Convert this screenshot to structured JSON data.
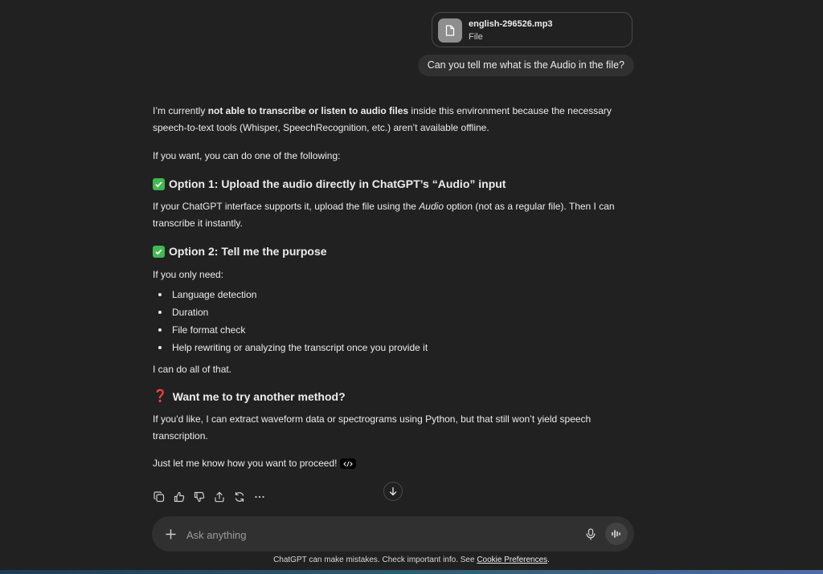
{
  "attachment": {
    "filename": "english-296526.mp3",
    "type_label": "File",
    "icon": "file-icon"
  },
  "user_message": "Can you tell me what is the Audio in the file?",
  "reply": {
    "p1_a": "I’m currently ",
    "p1_bold": "not able to transcribe or listen to audio files",
    "p1_b": " inside this environment because the necessary speech-to-text tools (Whisper, SpeechRecognition, etc.) aren’t available offline.",
    "p2": "If you want, you can do one of the following:",
    "h1": "Option 1: Upload the audio directly in ChatGPT’s “Audio” input",
    "p3_a": "If your ChatGPT interface supports it, upload the file using the ",
    "p3_em": "Audio",
    "p3_b": " option (not as a regular file). Then I can transcribe it instantly.",
    "h2": "Option 2: Tell me the purpose",
    "p4": "If you only need:",
    "list": [
      "Language detection",
      "Duration",
      "File format check",
      "Help rewriting or analyzing the transcript once you provide it"
    ],
    "p5": "I can do all of that.",
    "h3": "Want me to try another method?",
    "p6": "If you'd like, I can extract waveform data or spectrograms using Python, but that still won’t yield speech transcription.",
    "p7": "Just let me know how you want to proceed!"
  },
  "actions": [
    "copy-icon",
    "thumbs-up-icon",
    "thumbs-down-icon",
    "share-icon",
    "regenerate-icon",
    "more-icon"
  ],
  "composer": {
    "placeholder": "Ask anything"
  },
  "footer": {
    "text": "ChatGPT can make mistakes. Check important info. See ",
    "link": "Cookie Preferences",
    "end": "."
  },
  "colors": {
    "background": "#212121",
    "bubble": "#303030",
    "check": "#3fb950",
    "question": "#e02424"
  }
}
